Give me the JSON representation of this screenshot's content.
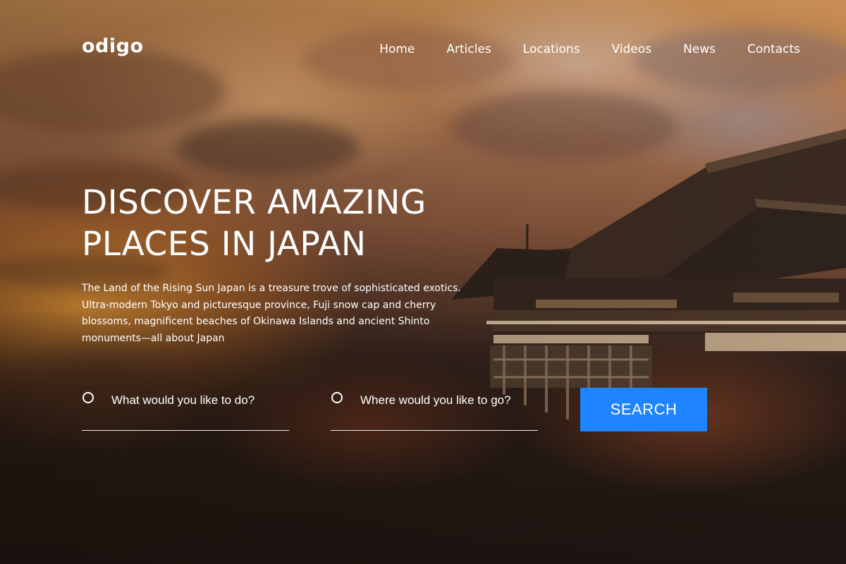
{
  "brand": {
    "logo_text": "odigo"
  },
  "nav": {
    "items": [
      {
        "label": "Home"
      },
      {
        "label": "Articles"
      },
      {
        "label": "Locations"
      },
      {
        "label": "Videos"
      },
      {
        "label": "News"
      },
      {
        "label": "Contacts"
      }
    ]
  },
  "hero": {
    "title_line1": "DISCOVER AMAZING",
    "title_line2": "PLACES IN JAPAN",
    "description": "The Land of the Rising Sun Japan is a treasure trove of sophisticated exotics. Ultra-modern Tokyo and picturesque province, Fuji snow cap and cherry blossoms, magnificent beaches of Okinawa Islands and ancient Shinto monuments—all about Japan"
  },
  "search": {
    "activity_label": "What would you like to do?",
    "destination_label": "Where would you like to go?",
    "button_label": "SEARCH"
  },
  "colors": {
    "accent": "#1e84ff",
    "text": "#ffffff"
  }
}
